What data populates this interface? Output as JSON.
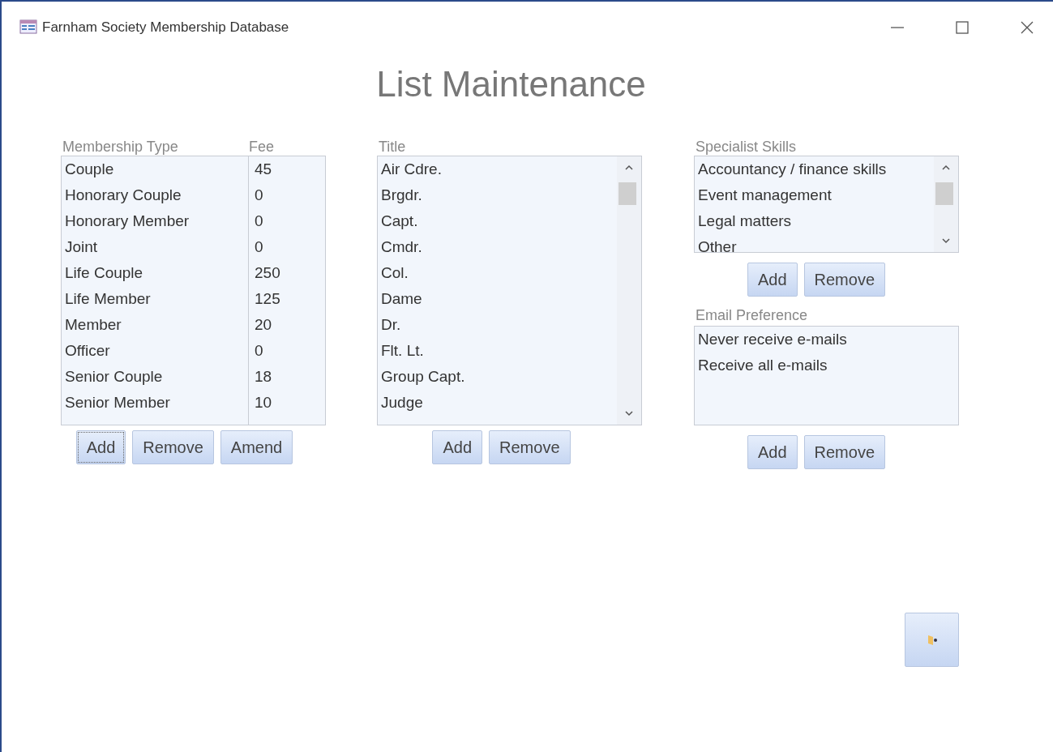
{
  "window": {
    "title": "Farnham Society Membership Database"
  },
  "heading": "List Maintenance",
  "membership": {
    "columns": [
      "Membership Type",
      "Fee"
    ],
    "rows": [
      {
        "type": "Couple",
        "fee": "45"
      },
      {
        "type": "Honorary Couple",
        "fee": "0"
      },
      {
        "type": "Honorary Member",
        "fee": "0"
      },
      {
        "type": "Joint",
        "fee": "0"
      },
      {
        "type": "Life Couple",
        "fee": "250"
      },
      {
        "type": "Life Member",
        "fee": "125"
      },
      {
        "type": "Member",
        "fee": "20"
      },
      {
        "type": "Officer",
        "fee": "0"
      },
      {
        "type": "Senior Couple",
        "fee": "18"
      },
      {
        "type": "Senior Member",
        "fee": "10"
      }
    ],
    "buttons": [
      "Add",
      "Remove",
      "Amend"
    ]
  },
  "title_list": {
    "label": "Title",
    "items": [
      "Air Cdre.",
      "Brgdr.",
      "Capt.",
      "Cmdr.",
      "Col.",
      "Dame",
      "Dr.",
      "Flt. Lt.",
      "Group Capt.",
      "Judge"
    ],
    "buttons": [
      "Add",
      "Remove"
    ]
  },
  "skills": {
    "label": "Specialist Skills",
    "items": [
      "Accountancy / finance skills",
      "Event management",
      "Legal matters",
      "Other"
    ],
    "buttons": [
      "Add",
      "Remove"
    ]
  },
  "email": {
    "label": "Email Preference",
    "items": [
      "Never receive e-mails",
      "Receive all e-mails"
    ],
    "buttons": [
      "Add",
      "Remove"
    ]
  }
}
